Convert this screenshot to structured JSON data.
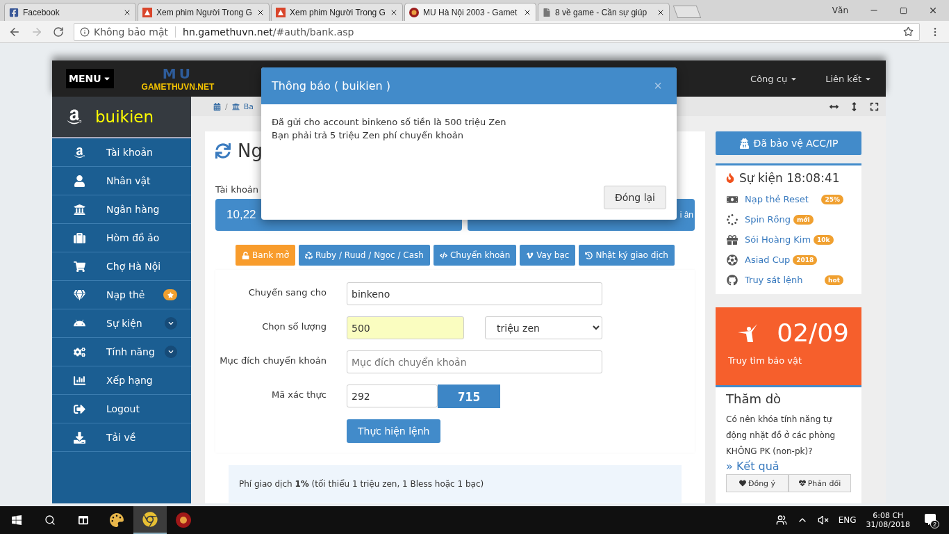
{
  "browser": {
    "tabs": [
      {
        "title": "Facebook",
        "selected": false,
        "kind": "facebook"
      },
      {
        "title": "Xem phim Người Trong G",
        "selected": false,
        "kind": "video"
      },
      {
        "title": "Xem phim Người Trong G",
        "selected": false,
        "kind": "video"
      },
      {
        "title": "MU Hà Nội 2003 - Gamet",
        "selected": true,
        "kind": "game"
      },
      {
        "title": "8 về game - Cần sự giúp",
        "selected": false,
        "kind": "page"
      }
    ],
    "profile": "Văn",
    "security": "Không bảo mật",
    "url_host": "hn.gamethuvn.net",
    "url_path": "/#auth/bank.asp"
  },
  "header": {
    "menu": "MENU",
    "logo_big": "MU",
    "logo": "GAMETHUVN.NET",
    "nav": [
      "Công cụ",
      "Liên kết"
    ]
  },
  "sidebar": {
    "user": "buikien",
    "items": [
      {
        "label": "Tài khoản",
        "kind": "plain"
      },
      {
        "label": "Nhân vật",
        "kind": "plain"
      },
      {
        "label": "Ngân hàng",
        "kind": "plain"
      },
      {
        "label": "Hòm đồ ảo",
        "kind": "plain"
      },
      {
        "label": "Chợ Hà Nội",
        "kind": "plain"
      },
      {
        "label": "Nạp thẻ",
        "kind": "star"
      },
      {
        "label": "Sự kiện",
        "kind": "submenu"
      },
      {
        "label": "Tính năng",
        "kind": "submenu"
      },
      {
        "label": "Xếp hạng",
        "kind": "plain"
      },
      {
        "label": "Logout",
        "kind": "plain"
      },
      {
        "label": "Tải về",
        "kind": "plain"
      }
    ]
  },
  "breadcrumb": {
    "separator": "/",
    "current": "Ba"
  },
  "bank": {
    "title": "Ng",
    "account_label": "Tài khoản",
    "tiles": [
      "10,22",
      "i ân"
    ],
    "actions": [
      {
        "label": "Bank mở",
        "kind": "warning"
      },
      {
        "label": "Ruby / Ruud / Ngọc / Cash",
        "kind": "primary"
      },
      {
        "label": "Chuyển khoản",
        "kind": "primary"
      },
      {
        "label": "Vay bạc",
        "kind": "primary"
      },
      {
        "label": "Nhật ký giao dịch",
        "kind": "primary"
      }
    ],
    "form": [
      {
        "label": "Chuyển sang cho",
        "kind": "text",
        "value": "binkeno"
      },
      {
        "label": "Chọn số lượng",
        "kind": "amount",
        "value": "500",
        "unit": "triệu zen"
      },
      {
        "label": "Mục đích chuyển khoản",
        "kind": "text",
        "placeholder": "Mục đích chuyển khoản"
      },
      {
        "label": "Mã xác thực",
        "kind": "captcha",
        "value": "292",
        "captcha": "715"
      }
    ],
    "submit": "Thực hiện lệnh",
    "note": "Phí giao dịch **1%** (tối thiểu 1 triệu zen, 1 Bless hoặc 1 bạc)"
  },
  "right": {
    "protect": "Đã bảo vệ ACC/IP",
    "events": {
      "title": "Sự kiện 18:08:41",
      "items": [
        {
          "label": "Nạp thẻ Reset",
          "badge": "25%",
          "kind": "aligned"
        },
        {
          "label": "Spin Rồng",
          "badge": "mới",
          "kind": "inline"
        },
        {
          "label": "Sói Hoàng Kim",
          "badge": "10k",
          "kind": "inline"
        },
        {
          "label": "Asiad Cup",
          "badge": "2018",
          "kind": "inline"
        },
        {
          "label": "Truy sát lệnh",
          "badge": "hot",
          "kind": "aligned"
        }
      ]
    },
    "treasure": {
      "date": "02/09",
      "label": "Truy tìm bảo vật"
    },
    "poll": {
      "title": "Thăm dò",
      "question": "Có nên khóa tính năng tự động nhặt đồ ở các phòng KHÔNG PK (non-pk)?",
      "link": "» Kết quả",
      "buttons": [
        "Đồng ý",
        "Phản đối"
      ]
    }
  },
  "modal": {
    "title": "Thông báo ( buikien )",
    "close": "×",
    "lines": [
      "Đã gửi cho account binkeno số tiền là 500 triệu Zen",
      "Bạn phải trả 5 triệu Zen phí chuyển khoản"
    ],
    "button": "Đóng lại"
  },
  "taskbar": {
    "apps": [
      {
        "kind": "paint",
        "selected": false
      },
      {
        "kind": "chrome",
        "selected": true
      },
      {
        "kind": "game",
        "selected": false
      }
    ],
    "language": "ENG",
    "time": "6:08 CH",
    "date": "31/08/2018",
    "notifications": "2"
  }
}
